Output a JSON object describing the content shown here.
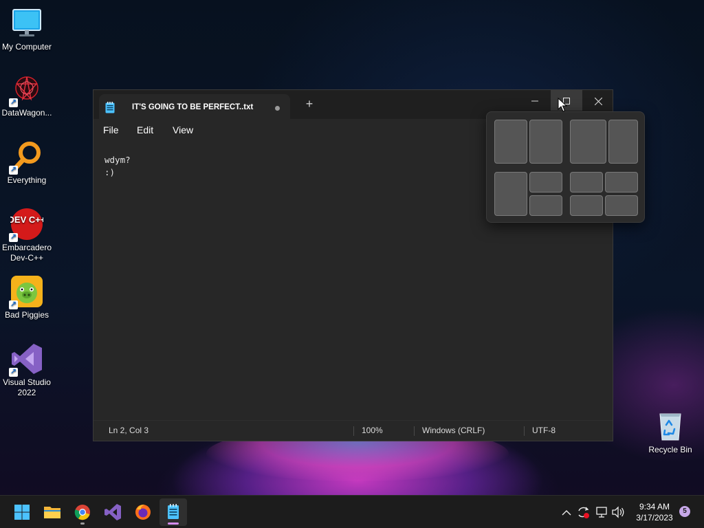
{
  "desktop": {
    "icons": [
      {
        "label": "My Computer",
        "icon": "monitor-icon"
      },
      {
        "label": "DataWagon...",
        "icon": "datawagon-icon"
      },
      {
        "label": "Everything",
        "icon": "everything-search-icon"
      },
      {
        "label": "Embarcadero Dev-C++",
        "icon": "devcpp-icon"
      },
      {
        "label": "Bad Piggies",
        "icon": "bad-piggies-icon"
      },
      {
        "label": "Visual Studio 2022",
        "icon": "visual-studio-icon"
      },
      {
        "label": "Recycle Bin",
        "icon": "recycle-bin-icon"
      }
    ],
    "devcpp_logo_text": "DEV C++"
  },
  "notepad": {
    "tab_title": "IT'S GOING TO BE PERFECT..txt",
    "new_tab_label": "+",
    "menu": [
      "File",
      "Edit",
      "View"
    ],
    "content_lines": [
      "wdym?",
      ":)"
    ],
    "status": {
      "position": "Ln 2, Col 3",
      "zoom": "100%",
      "line_ending": "Windows (CRLF)",
      "encoding": "UTF-8"
    },
    "buttons": {
      "minimize": "minimize-icon",
      "maximize": "maximize-icon",
      "close": "close-icon"
    }
  },
  "snap_layouts": {
    "layouts": [
      "half-half",
      "two-thirds-one-third",
      "half-quarters",
      "quarters"
    ]
  },
  "taskbar": {
    "apps": [
      "start",
      "file-explorer",
      "chrome",
      "visual-studio",
      "firefox",
      "notepad"
    ],
    "active_app": "notepad",
    "clock_time": "9:34 AM",
    "clock_date": "3/17/2023",
    "notification_count": "5"
  },
  "colors": {
    "accent": "#60cdff",
    "window_bg": "#272727",
    "titlebar_bg": "#1f1f1f",
    "taskbar_bg": "#1c1c1c"
  }
}
